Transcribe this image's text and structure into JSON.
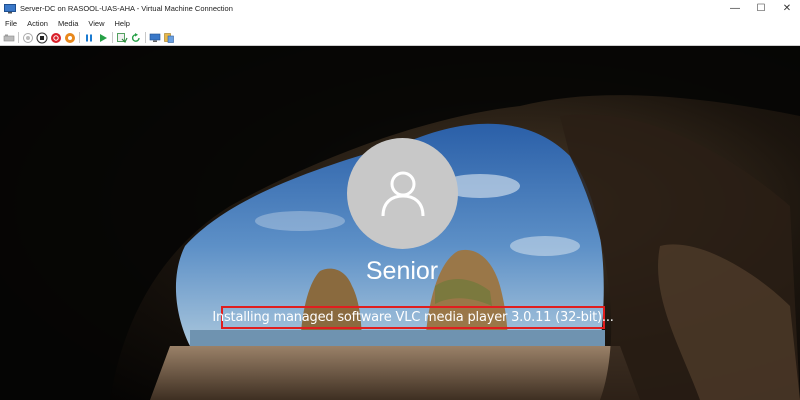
{
  "window": {
    "title": "Server-DC on RASOOL-UAS-AHA - Virtual Machine Connection",
    "controls": {
      "minimize": "—",
      "maximize": "☐",
      "close": "✕"
    }
  },
  "menu": {
    "items": [
      "File",
      "Action",
      "Media",
      "View",
      "Help"
    ]
  },
  "toolbar": {
    "buttons": [
      "ctrl-alt-del-icon",
      "start-icon",
      "turn-off-icon",
      "shutdown-icon",
      "save-icon",
      "pause-icon",
      "resume-icon",
      "checkpoint-icon",
      "revert-icon",
      "enhanced-session-icon",
      "share-icon"
    ]
  },
  "login": {
    "username": "Senior",
    "status": "Installing managed software VLC media player 3.0.11 (32-bit)..."
  },
  "colors": {
    "highlight_border": "#e01e1e",
    "avatar_bg": "#c8c8c8"
  }
}
